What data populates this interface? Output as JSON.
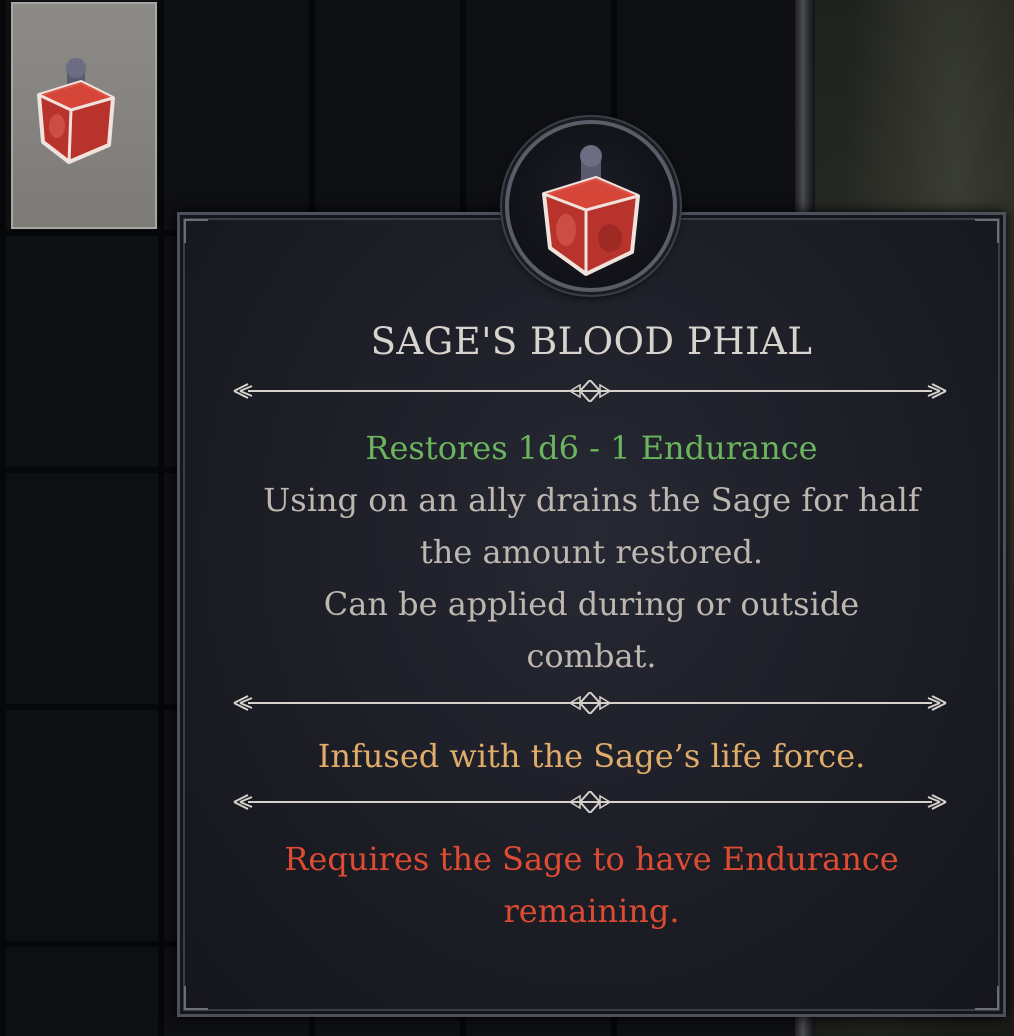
{
  "item": {
    "name": "SAGE'S BLOOD PHIAL",
    "icon": "blood-phial-icon",
    "effect": "Restores 1d6 - 1 Endurance",
    "description_lines": [
      "Using on an ally drains the Sage for half",
      "the amount restored.",
      "Can be applied during or outside",
      "combat."
    ],
    "flavor": "Infused with the Sage’s life force.",
    "requirement_lines": [
      "Requires the Sage to have Endurance",
      "remaining."
    ]
  },
  "colors": {
    "effect": "#6bb55e",
    "description": "#bdb7b0",
    "flavor": "#e0ac6a",
    "requirement": "#de4b33",
    "title": "#d8d3cc"
  }
}
